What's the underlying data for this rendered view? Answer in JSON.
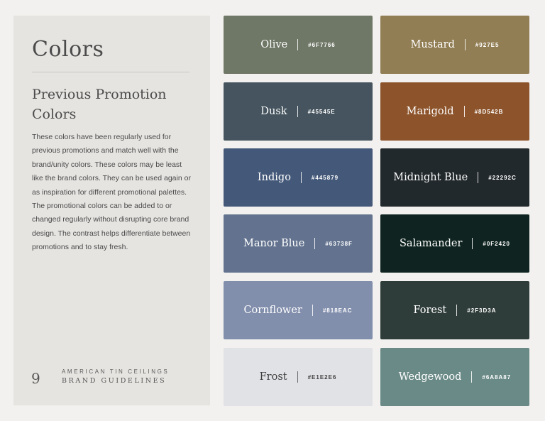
{
  "sidebar": {
    "title": "Colors",
    "subtitle": "Previous Promotion Colors",
    "body": "These colors have been regularly used for previous promotions and match well with the brand/unity colors. These colors may be least like the brand colors. They can be used again or as inspiration for different promotional palettes. The promotional colors can be added to or changed regularly without disrupting core brand design. The contrast helps differentiate between promotions and to stay fresh.",
    "page_number": "9",
    "brand_line_1": "AMERICAN TIN CEILINGS",
    "brand_line_2": "BRAND GUIDELINES"
  },
  "colors": [
    {
      "name": "Olive",
      "hex": "#6F7766",
      "color": "#6F7766"
    },
    {
      "name": "Mustard",
      "hex": "#927E5",
      "color": "#927E54"
    },
    {
      "name": "Dusk",
      "hex": "#45545E",
      "color": "#45545E"
    },
    {
      "name": "Marigold",
      "hex": "#8D542B",
      "color": "#8D542B"
    },
    {
      "name": "Indigo",
      "hex": "#445879",
      "color": "#445879"
    },
    {
      "name": "Midnight Blue",
      "hex": "#22292C",
      "color": "#22292C"
    },
    {
      "name": "Manor Blue",
      "hex": "#63738F",
      "color": "#63738F"
    },
    {
      "name": "Salamander",
      "hex": "#0F2420",
      "color": "#0F2420"
    },
    {
      "name": "Cornflower",
      "hex": "#818EAC",
      "color": "#818EAC"
    },
    {
      "name": "Forest",
      "hex": "#2F3D3A",
      "color": "#2F3D3A"
    },
    {
      "name": "Frost",
      "hex": "#E1E2E6",
      "color": "#E1E2E6"
    },
    {
      "name": "Wedgewood",
      "hex": "#6A8A87",
      "color": "#6A8A87"
    }
  ]
}
